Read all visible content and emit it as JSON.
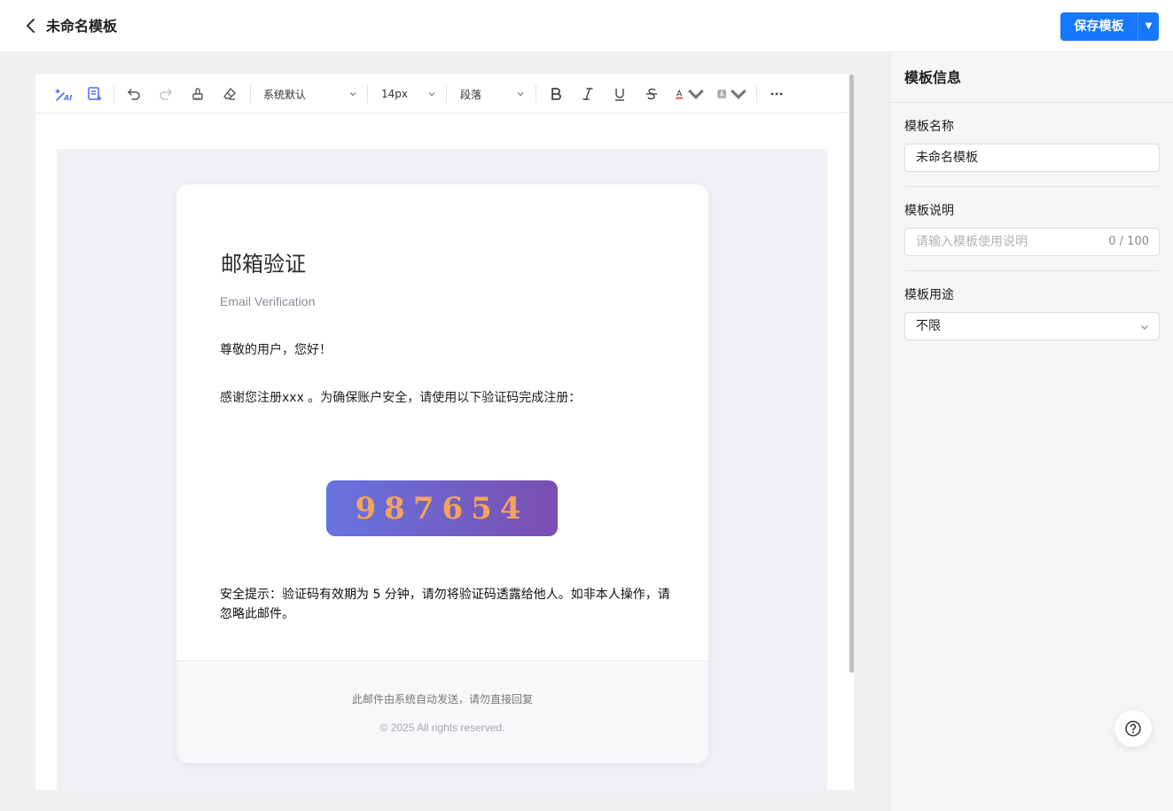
{
  "header": {
    "title": "未命名模板",
    "save_label": "保存模板",
    "save_dropdown_glyph": "▼"
  },
  "toolbar": {
    "font_family": "系统默认",
    "font_size": "14px",
    "paragraph": "段落",
    "icons": [
      "ai-write-icon",
      "template-icon",
      "undo-icon",
      "redo-icon",
      "format-painter-icon",
      "clear-format-icon",
      "bold-icon",
      "italic-icon",
      "underline-icon",
      "strikethrough-icon",
      "font-color-icon",
      "highlight-color-icon",
      "more-icon"
    ]
  },
  "email": {
    "heading": "邮箱验证",
    "subheading": "Email Verification",
    "greeting": "尊敬的用户，您好！",
    "body": "感谢您注册xxx 。为确保账户安全，请使用以下验证码完成注册：",
    "code": "987654",
    "tip": "安全提示：验证码有效期为 5 分钟，请勿将验证码透露给他人。如非本人操作，请忽略此邮件。",
    "footer_note": "此邮件由系统自动发送，请勿直接回复",
    "copyright": "© 2025 All rights reserved."
  },
  "panel": {
    "title": "模板信息",
    "name_label": "模板名称",
    "name_value": "未命名模板",
    "desc_label": "模板说明",
    "desc_placeholder": "请输入模板使用说明",
    "desc_counter": "0 / 100",
    "usage_label": "模板用途",
    "usage_value": "不限"
  },
  "colors": {
    "primary": "#1677ff",
    "code_gradient_start": "#6674e0",
    "code_gradient_end": "#7b4fb0",
    "code_text": "#f5a35c",
    "font_color_underline": "#e02020"
  }
}
